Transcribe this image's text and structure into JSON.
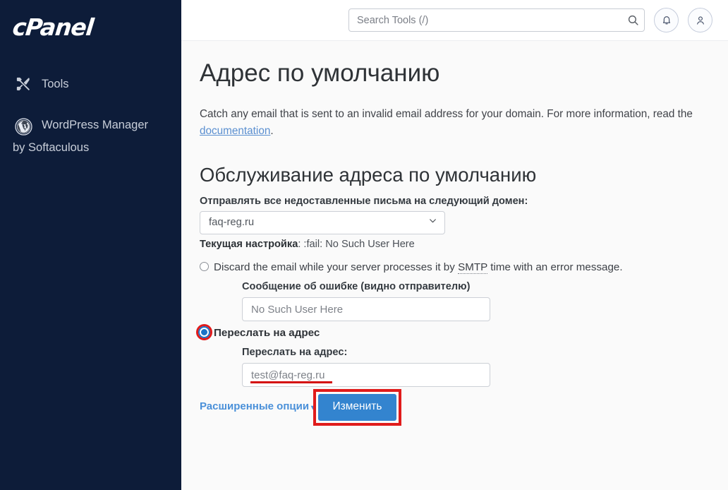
{
  "sidebar": {
    "brand": "cPanel",
    "items": [
      {
        "label": "Tools",
        "icon": "tools-icon"
      },
      {
        "label": "WordPress Manager",
        "sub": "by Softaculous",
        "icon": "wordpress-icon"
      }
    ]
  },
  "topbar": {
    "search_placeholder": "Search Tools (/)",
    "search_value": "",
    "search_icon": "search-icon",
    "notifications_icon": "bell-icon",
    "account_icon": "user-icon"
  },
  "page": {
    "title": "Адрес по умолчанию",
    "intro_before": "Catch any email that is sent to an invalid email address for your domain. For more information, read the ",
    "intro_link": "documentation",
    "intro_after": "."
  },
  "form": {
    "section_title": "Обслуживание адреса по умолчанию",
    "domain_label": "Отправлять все недоставленные письма на следующий домен:",
    "domain_selected": "faq-reg.ru",
    "domain_options": [
      "faq-reg.ru"
    ],
    "current_setting_label": "Текущая настройка",
    "current_setting_value": ": :fail: No Such User Here",
    "discard": {
      "selected": false,
      "label_part1": "Discard the email while your server processes it by ",
      "label_abbr": "SMTP",
      "label_part2": " time with an error message.",
      "error_message_label": "Сообщение об ошибке (видно отправителю)",
      "error_message_value": "No Such User Here"
    },
    "forward": {
      "selected": true,
      "label": "Переслать на адрес",
      "address_label": "Переслать на адрес:",
      "address_value": "test@faq-reg.ru"
    },
    "advanced_options": "Расширенные опции",
    "advanced_caret": "▾",
    "submit_label": "Изменить"
  },
  "colors": {
    "sidebar_bg": "#0d1c39",
    "content_bg": "#fafafa",
    "primary_button": "#3384cf",
    "link": "#4a90d9",
    "annotation_red": "#e01b1b",
    "radio_blue": "#1a73c7"
  }
}
